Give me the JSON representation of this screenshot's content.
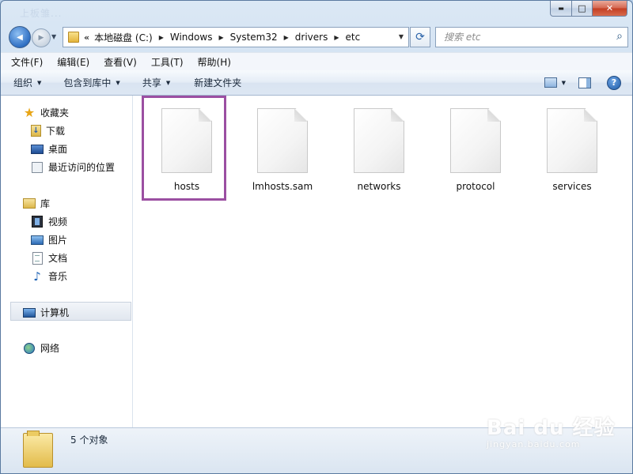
{
  "window": {
    "ghost_title": "上板雏...",
    "min_icon": "▬",
    "max_icon": "□",
    "close_icon": "✕"
  },
  "nav": {
    "back_icon": "◀",
    "forward_icon": "▶",
    "dropdown_icon": "▼",
    "address_chevron": "«",
    "breadcrumbs": [
      "本地磁盘 (C:)",
      "Windows",
      "System32",
      "drivers",
      "etc"
    ],
    "breadcrumb_sep": "▶",
    "address_dropdown_icon": "▼",
    "refresh_icon": "⟳",
    "search_placeholder": "搜索 etc",
    "search_icon": "⌕"
  },
  "menu": [
    "文件(F)",
    "编辑(E)",
    "查看(V)",
    "工具(T)",
    "帮助(H)"
  ],
  "commands": {
    "organize": "组织",
    "include_in_library": "包含到库中",
    "share": "共享",
    "new_folder": "新建文件夹",
    "dropdown_icon": "▼",
    "help_icon": "?"
  },
  "sidebar": {
    "favorites": {
      "header": "收藏夹",
      "items": [
        "下载",
        "桌面",
        "最近访问的位置"
      ]
    },
    "libraries": {
      "header": "库",
      "items": [
        "视频",
        "图片",
        "文档",
        "音乐"
      ]
    },
    "computer": "计算机",
    "network": "网络",
    "icons": {
      "star": "★",
      "music": "♪",
      "download_arrow": "↓"
    }
  },
  "files": [
    "hosts",
    "lmhosts.sam",
    "networks",
    "protocol",
    "services"
  ],
  "status": {
    "text": "5 个对象"
  },
  "watermark": {
    "logo": "Bai du 经验",
    "sub": "jingyan.baidu.com"
  },
  "colors": {
    "highlight_border": "#9b4fa2",
    "window_frame": "#bcd2ea"
  }
}
